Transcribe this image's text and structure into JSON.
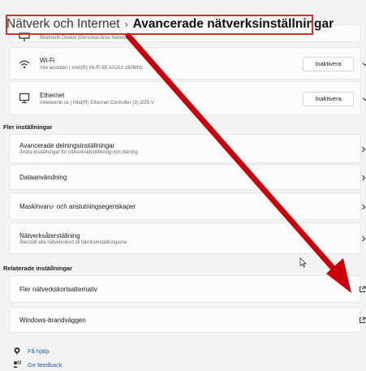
{
  "breadcrumb": {
    "parent": "Nätverk och Internet",
    "separator": "›",
    "current": "Avancerade nätverksinställningar"
  },
  "adapters": [
    {
      "title": "",
      "subtitle": "Bluetooth Device (Personal Area Network)",
      "icon": "bluetooth-network-icon"
    },
    {
      "title": "Wi-Fi",
      "subtitle": "Inte ansluten | Intel(R) Wi-Fi 6E AX210 160MHz",
      "button": "Inaktivera",
      "icon": "wifi-icon"
    },
    {
      "title": "Ethernet",
      "subtitle": "milleteknik.se | Intel(R) Ethernet Controller (3) I225-V",
      "button": "Inaktivera",
      "icon": "ethernet-icon"
    }
  ],
  "more_settings": {
    "heading": "Fler inställningar",
    "items": [
      {
        "title": "Avancerade delningsinställningar",
        "subtitle": "Ändra inställningar för nätverksidentifiering och delning"
      },
      {
        "title": "Dataanvändning",
        "subtitle": ""
      },
      {
        "title": "Maskinvaru- och anslutningsegenskaper",
        "subtitle": ""
      },
      {
        "title": "Nätverksåterställning",
        "subtitle": "Återställ alla nätverkskort till fabriksinställningarna"
      }
    ]
  },
  "related_settings": {
    "heading": "Relaterade inställningar",
    "items": [
      {
        "title": "Fler nätverkskortsalternativ"
      },
      {
        "title": "Windows-brandväggen"
      }
    ]
  },
  "footer_links": [
    {
      "label": "Få hjälp",
      "icon": "help-icon"
    },
    {
      "label": "Ge feedback",
      "icon": "feedback-icon"
    }
  ],
  "annotation_color": "#c8000a",
  "accent_color": "#1a5fb4"
}
